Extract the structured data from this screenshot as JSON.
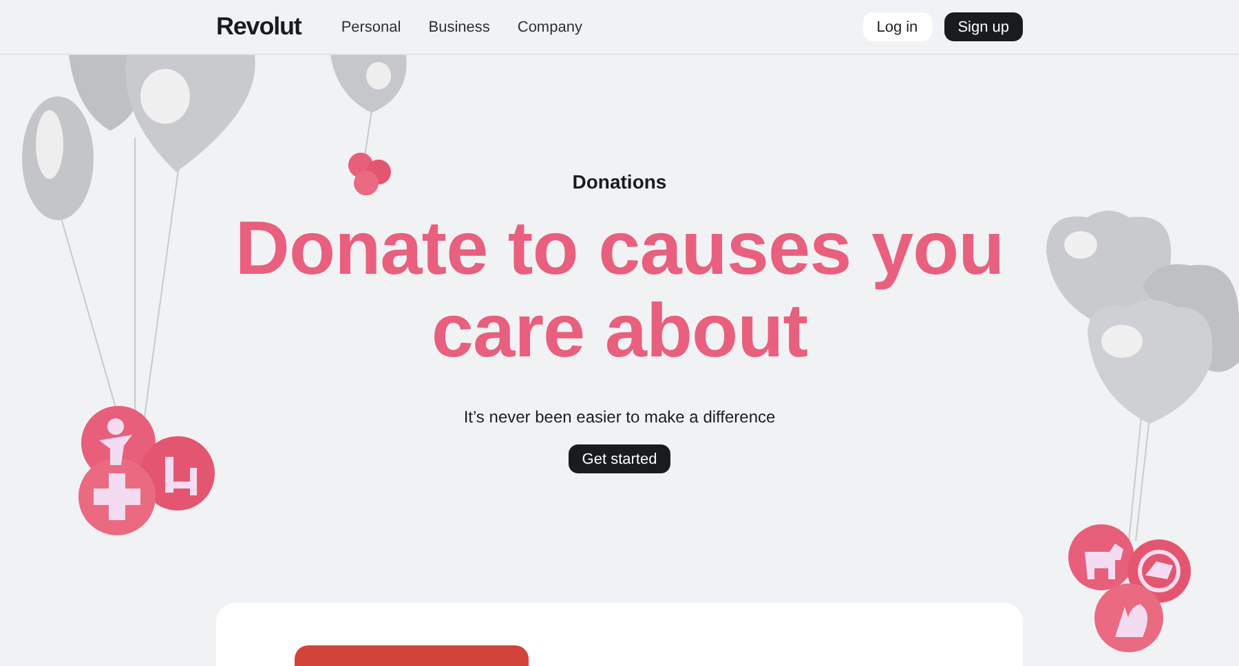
{
  "header": {
    "logo": "Revolut",
    "nav": [
      "Personal",
      "Business",
      "Company"
    ],
    "login": "Log in",
    "signup": "Sign up"
  },
  "hero": {
    "eyebrow": "Donations",
    "title": "Donate to causes you care about",
    "subtitle": "It’s never been easier to make a difference",
    "cta": "Get started"
  }
}
